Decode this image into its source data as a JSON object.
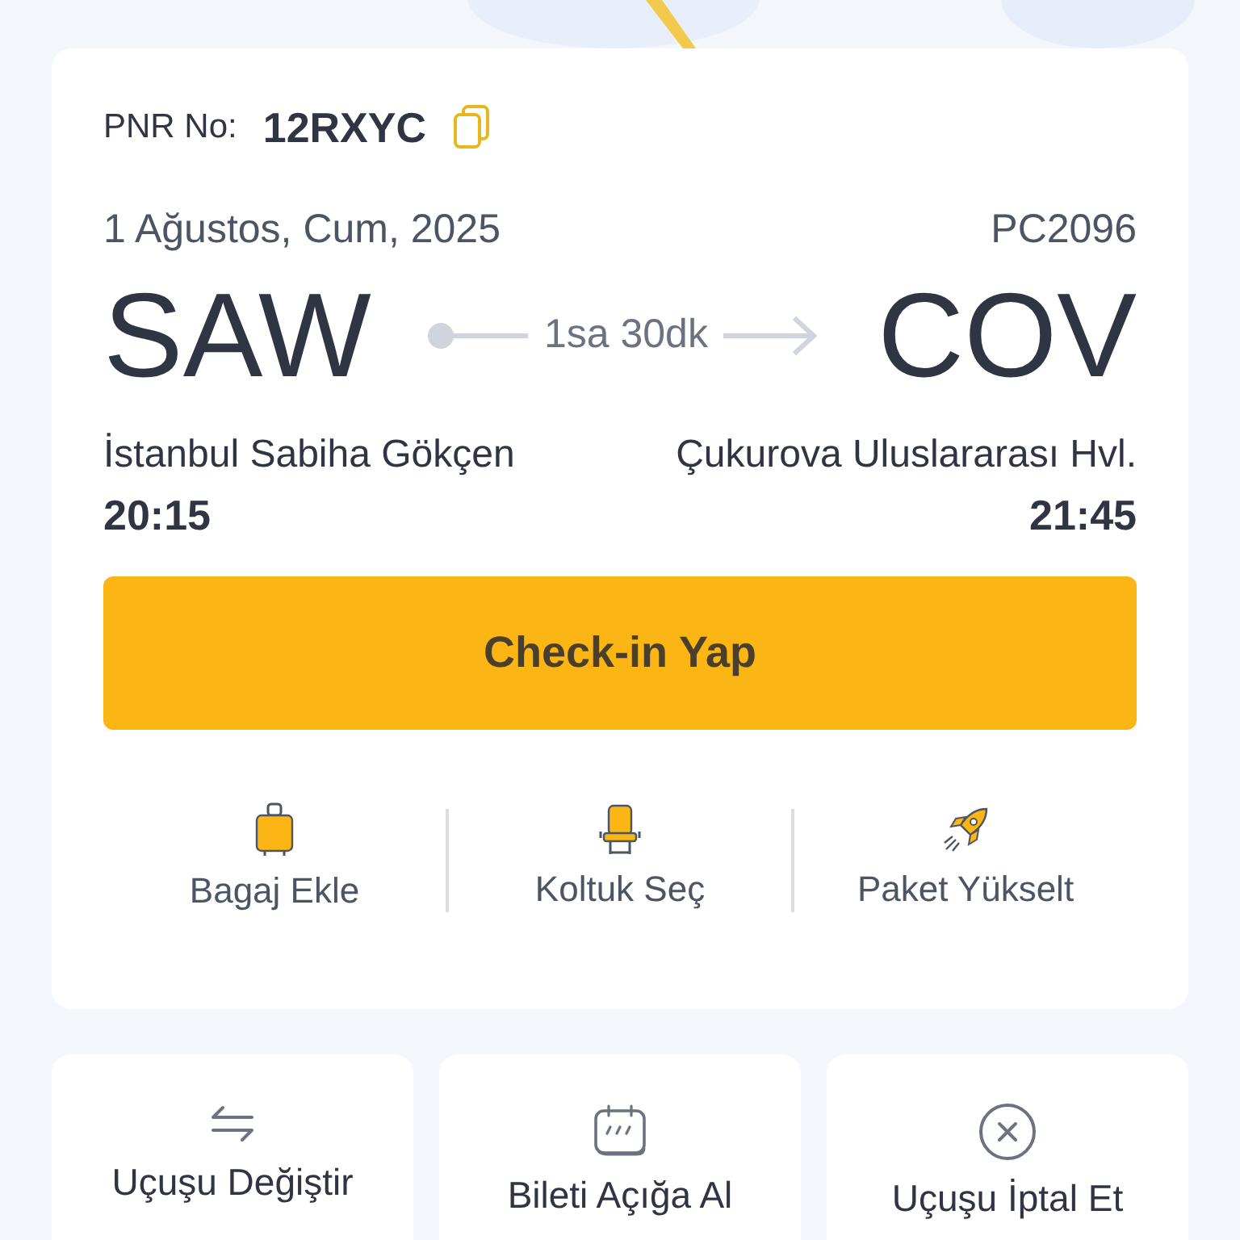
{
  "booking": {
    "pnr_label": "PNR No:",
    "pnr": "12RXYC",
    "date": "1 Ağustos, Cum, 2025",
    "flight_no": "PC2096",
    "origin": {
      "code": "SAW",
      "airport": "İstanbul Sabiha Gökçen",
      "time": "20:15"
    },
    "destination": {
      "code": "COV",
      "airport": "Çukurova Uluslararası Hvl.",
      "time": "21:45"
    },
    "duration": "1sa 30dk",
    "checkin_button": "Check-in Yap"
  },
  "quick_actions": [
    {
      "kind": "baggage",
      "label": "Bagaj Ekle"
    },
    {
      "kind": "seat",
      "label": "Koltuk Seç"
    },
    {
      "kind": "upgrade",
      "label": "Paket Yükselt"
    }
  ],
  "flight_actions": [
    {
      "kind": "change",
      "label": "Uçuşu Değiştir"
    },
    {
      "kind": "open_ticket",
      "label": "Bileti Açığa Al"
    },
    {
      "kind": "cancel",
      "label": "Uçuşu İptal Et"
    }
  ]
}
